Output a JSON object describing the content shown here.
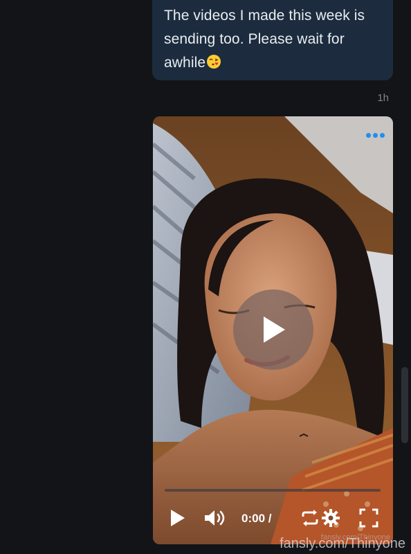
{
  "message": {
    "text": "The videos I made this week is\nsending too. Please wait for\nawhile",
    "emoji": "kissing-face-emoji",
    "timestamp": "1h"
  },
  "video": {
    "timecode": "0:00 /",
    "progress": 0,
    "watermark_small": "fansly.com/Thinyone"
  },
  "watermark": "fansly.com/Thinyone",
  "colors": {
    "background": "#121417",
    "bubble": "#1c2c3e",
    "accent": "#1e8ff0"
  },
  "icons": [
    "more-options-icon",
    "play-icon",
    "volume-icon",
    "loop-icon",
    "settings-icon",
    "fullscreen-icon"
  ]
}
